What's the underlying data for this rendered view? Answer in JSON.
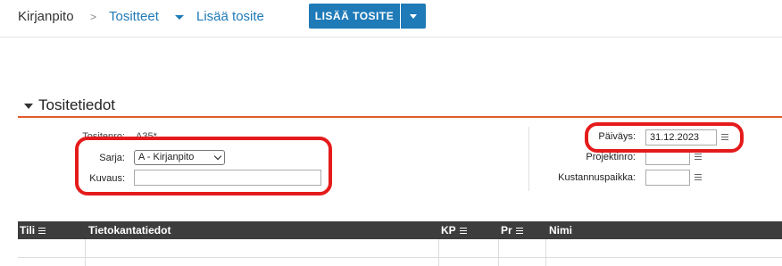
{
  "breadcrumb": {
    "root": "Kirjanpito",
    "separator": ">",
    "section": "Tositteet",
    "current": "Lisää tosite"
  },
  "toolbar": {
    "add_button": "LISÄÄ TOSITE",
    "add_button_color": "#1f7ab8"
  },
  "section": {
    "title": "Tositetiedot",
    "accent_color": "#e05a2b"
  },
  "form": {
    "tositenro_label": "Tositenro:",
    "tositenro_value": "A35*",
    "sarja_label": "Sarja:",
    "sarja_value": "A - Kirjanpito",
    "kuvaus_label": "Kuvaus:",
    "kuvaus_value": "",
    "paivays_label": "Päiväys:",
    "paivays_value": "31.12.2023",
    "projektinro_label": "Projektinro:",
    "projektinro_value": "",
    "kustannuspaikka_label": "Kustannuspaikka:",
    "kustannuspaikka_value": ""
  },
  "grid": {
    "columns": [
      "Tili",
      "Tietokantatiedot",
      "KP",
      "Pr",
      "Nimi"
    ]
  },
  "highlight_color": "#e51b1b"
}
